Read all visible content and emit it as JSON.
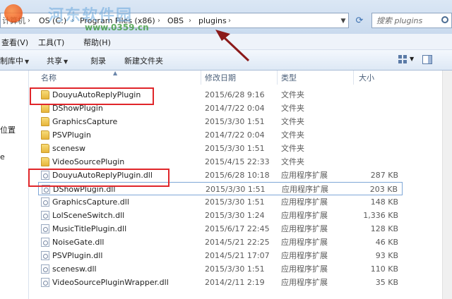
{
  "watermark": {
    "title": "河东软件园",
    "url": "www.0359.cn"
  },
  "address": {
    "crumbs": [
      {
        "label": "OS (C:)"
      },
      {
        "label": "Program Files (x86)"
      },
      {
        "label": "OBS"
      },
      {
        "label": "plugins"
      }
    ],
    "left_fragment": "计算机"
  },
  "search": {
    "placeholder": "搜索 plugins"
  },
  "menubar": {
    "items": [
      "查看(V)",
      "工具(T)",
      "帮助(H)"
    ]
  },
  "toolbar": {
    "items": [
      "制库中",
      "共享",
      "刻录",
      "新建文件夹"
    ]
  },
  "navpane": {
    "fragments": [
      "位置",
      "e"
    ]
  },
  "columns": {
    "name": "名称",
    "date": "修改日期",
    "type": "类型",
    "size": "大小"
  },
  "files": [
    {
      "name": "DouyuAutoReplyPlugin",
      "date": "2015/6/28 9:16",
      "type": "文件夹",
      "size": "",
      "kind": "folder"
    },
    {
      "name": "DShowPlugin",
      "date": "2014/7/22 0:04",
      "type": "文件夹",
      "size": "",
      "kind": "folder"
    },
    {
      "name": "GraphicsCapture",
      "date": "2015/3/30 1:51",
      "type": "文件夹",
      "size": "",
      "kind": "folder"
    },
    {
      "name": "PSVPlugin",
      "date": "2014/7/22 0:04",
      "type": "文件夹",
      "size": "",
      "kind": "folder"
    },
    {
      "name": "scenesw",
      "date": "2015/3/30 1:51",
      "type": "文件夹",
      "size": "",
      "kind": "folder"
    },
    {
      "name": "VideoSourcePlugin",
      "date": "2015/4/15 22:33",
      "type": "文件夹",
      "size": "",
      "kind": "folder"
    },
    {
      "name": "DouyuAutoReplyPlugin.dll",
      "date": "2015/6/28 10:18",
      "type": "应用程序扩展",
      "size": "287 KB",
      "kind": "dll"
    },
    {
      "name": "DShowPlugin.dll",
      "date": "2015/3/30 1:51",
      "type": "应用程序扩展",
      "size": "203 KB",
      "kind": "dll"
    },
    {
      "name": "GraphicsCapture.dll",
      "date": "2015/3/30 1:51",
      "type": "应用程序扩展",
      "size": "148 KB",
      "kind": "dll"
    },
    {
      "name": "LolSceneSwitch.dll",
      "date": "2015/3/30 1:24",
      "type": "应用程序扩展",
      "size": "1,336 KB",
      "kind": "dll"
    },
    {
      "name": "MusicTitlePlugin.dll",
      "date": "2015/6/17 22:45",
      "type": "应用程序扩展",
      "size": "128 KB",
      "kind": "dll"
    },
    {
      "name": "NoiseGate.dll",
      "date": "2014/5/21 22:25",
      "type": "应用程序扩展",
      "size": "46 KB",
      "kind": "dll"
    },
    {
      "name": "PSVPlugin.dll",
      "date": "2014/5/21 17:07",
      "type": "应用程序扩展",
      "size": "93 KB",
      "kind": "dll"
    },
    {
      "name": "scenesw.dll",
      "date": "2015/3/30 1:51",
      "type": "应用程序扩展",
      "size": "110 KB",
      "kind": "dll"
    },
    {
      "name": "VideoSourcePluginWrapper.dll",
      "date": "2014/2/11 2:19",
      "type": "应用程序扩展",
      "size": "35 KB",
      "kind": "dll"
    }
  ],
  "selected_index": 7,
  "colors": {
    "highlight": "#e0262a",
    "arrow": "#8b1a1a"
  }
}
